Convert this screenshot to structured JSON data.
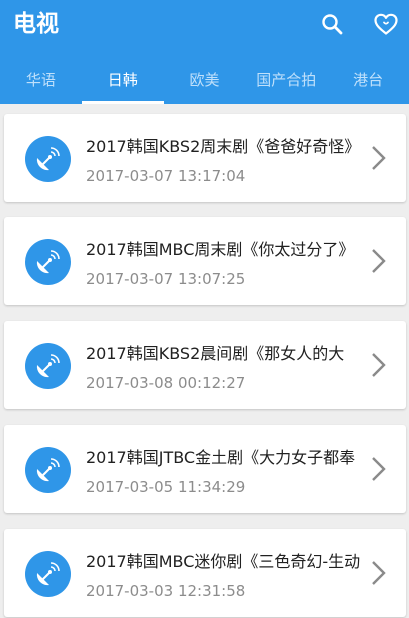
{
  "header": {
    "title": "电视"
  },
  "tabs": [
    {
      "label": "华语"
    },
    {
      "label": "日韩"
    },
    {
      "label": "欧美"
    },
    {
      "label": "国产合拍"
    },
    {
      "label": "港台"
    }
  ],
  "active_tab": 1,
  "items": [
    {
      "title": "2017韩国KBS2周末剧《爸爸好奇怪》",
      "date": "2017-03-07 13:17:04"
    },
    {
      "title": "2017韩国MBC周末剧《你太过分了》",
      "date": "2017-03-07 13:07:25"
    },
    {
      "title": "2017韩国KBS2晨间剧《那女人的大",
      "date": "2017-03-08 00:12:27"
    },
    {
      "title": "2017韩国JTBC金土剧《大力女子都奉",
      "date": "2017-03-05 11:34:29"
    },
    {
      "title": "2017韩国MBC迷你剧《三色奇幻-生动",
      "date": "2017-03-03 12:31:58"
    }
  ],
  "colors": {
    "primary": "#2f96e8",
    "background": "#eeeeee"
  },
  "icons": {
    "search": "search-icon",
    "favorite": "heart-icon",
    "item": "satellite-dish-icon",
    "chevron": "chevron-right-icon"
  }
}
